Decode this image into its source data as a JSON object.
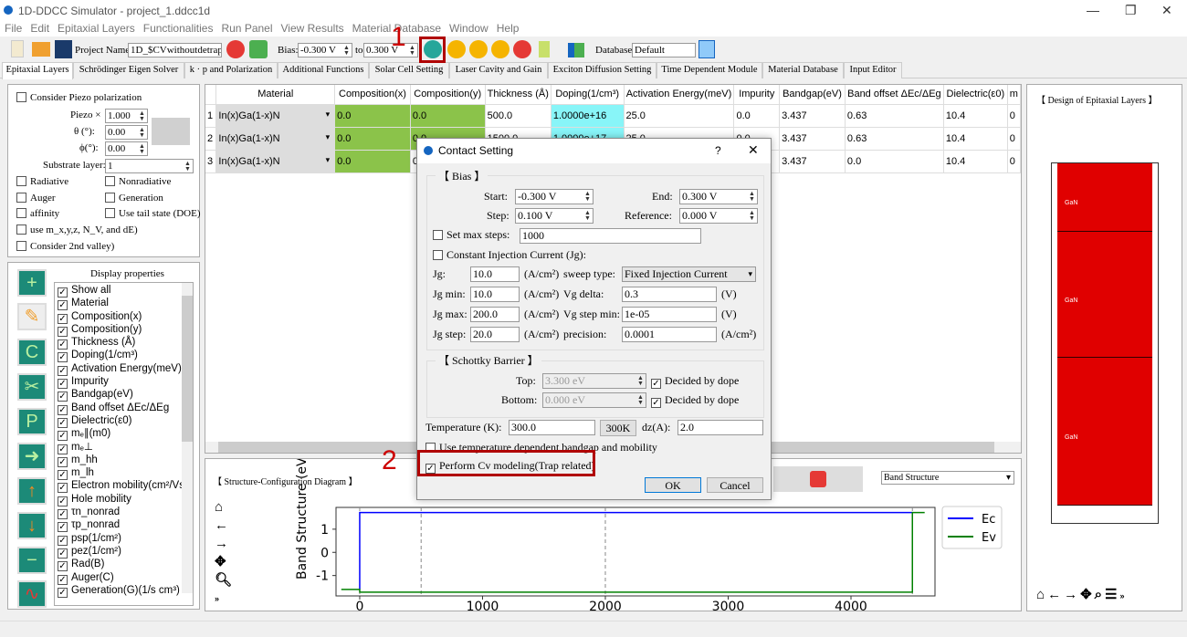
{
  "window": {
    "title": "1D-DDCC Simulator - project_1.ddcc1d"
  },
  "menu": [
    "File",
    "Edit",
    "Epitaxial Layers",
    "Functionalities",
    "Run Panel",
    "View Results",
    "Material Database",
    "Window",
    "Help"
  ],
  "toolbar": {
    "project_label": "Project Name:",
    "project_value": "1D_$CVwithoutdetrap",
    "bias_label": "Bias:",
    "bias_from": "-0.300 V",
    "to_label": "to",
    "bias_to": "0.300 V",
    "database_label": "Database:",
    "database_value": "Default"
  },
  "tabs": [
    "Epitaxial Layers",
    "Schrödinger Eigen Solver",
    "k · p and Polarization",
    "Additional Functions",
    "Solar Cell Setting",
    "Laser Cavity and Gain",
    "Exciton Diffusion Setting",
    "Time Dependent Module",
    "Material Database",
    "Input Editor"
  ],
  "left_top": {
    "piezo_label": "Consider Piezo polarization",
    "piezo_x_label": "Piezo ×",
    "piezo_x": "1.000",
    "theta_label": "θ (°):",
    "theta": "0.00",
    "phi_label": "ϕ(°):",
    "phi": "0.00",
    "substrate_label": "Substrate layer:",
    "substrate": "1",
    "checks": [
      "Radiative",
      "Nonradiative",
      "Auger",
      "Generation",
      "affinity",
      "Use tail state (DOE)",
      "use m_x,y,z, N_V, and dE)",
      "Consider 2nd valley)"
    ]
  },
  "display": {
    "title": "Display properties",
    "items": [
      "Show all",
      "Material",
      "Composition(x)",
      "Composition(y)",
      "Thickness (Å)",
      "Doping(1/cm³)",
      "Activation Energy(meV)",
      "Impurity",
      "Bandgap(eV)",
      "Band offset ΔEc/ΔEg",
      "Dielectric(ε0)",
      "mₑ∥(m0)",
      "mₑ⊥",
      "m_hh",
      "m_lh",
      "Electron mobility(cm²/Vs)",
      "Hole mobility",
      "τn_nonrad",
      "τp_nonrad",
      "psp(1/cm²)",
      "pez(1/cm²)",
      "Rad(B)",
      "Auger(C)",
      "Generation(G)(1/s cm³)"
    ]
  },
  "table": {
    "headers": [
      "Material",
      "Composition(x)",
      "Composition(y)",
      "Thickness (Å)",
      "Doping(1/cm³)",
      "Activation Energy(meV)",
      "Impurity",
      "Bandgap(eV)",
      "Band offset ΔEc/ΔEg",
      "Dielectric(ε0)",
      "m"
    ],
    "rows": [
      [
        "1",
        "In(x)Ga(1-x)N",
        "0.0",
        "0.0",
        "500.0",
        "1.0000e+16",
        "25.0",
        "0.0",
        "3.437",
        "0.63",
        "10.4",
        "0"
      ],
      [
        "2",
        "In(x)Ga(1-x)N",
        "0.0",
        "0.0",
        "1500.0",
        "1.0000e+17",
        "25.0",
        "0.0",
        "3.437",
        "0.63",
        "10.4",
        "0"
      ],
      [
        "3",
        "In(x)Ga(1-x)N",
        "0.0",
        "0.0",
        "",
        "",
        "",
        "",
        "3.437",
        "0.0",
        "10.4",
        "0"
      ]
    ]
  },
  "structure": {
    "title": "【 Structure-Configuration Diagram 】",
    "plot_select": "Band Structure"
  },
  "design": {
    "title": "【 Design of Epitaxial Layers 】",
    "layers": [
      "GaN",
      "GaN",
      "GaN"
    ],
    "layer_color": "#e00000"
  },
  "dialog": {
    "title": "Contact Setting",
    "help": "?",
    "close": "✕",
    "bias_group": "【 Bias 】",
    "start_label": "Start:",
    "start": "-0.300 V",
    "end_label": "End:",
    "end": "0.300 V",
    "step_label": "Step:",
    "step": "0.100 V",
    "reference_label": "Reference:",
    "reference": "0.000 V",
    "max_steps_label": "Set max steps:",
    "max_steps": "1000",
    "const_inj_label": "Constant Injection Current (Jg):",
    "jg_label": "Jg:",
    "jg": "10.0",
    "jg_min_label": "Jg min:",
    "jg_min": "10.0",
    "jg_max_label": "Jg max:",
    "jg_max": "200.0",
    "jg_step_label": "Jg step:",
    "jg_step": "20.0",
    "unit_acm2": "(A/cm²)",
    "unit_v": "(V)",
    "sweep_label": "sweep type:",
    "sweep": "Fixed Injection Current",
    "vg_delta_label": "Vg delta:",
    "vg_delta": "0.3",
    "vg_step_min_label": "Vg step min:",
    "vg_step_min": "1e-05",
    "precision_label": "precision:",
    "precision": "0.0001",
    "schottky_group": "【 Schottky Barrier 】",
    "top_label": "Top:",
    "top": "3.300 eV",
    "bottom_label": "Bottom:",
    "bottom": "0.000 eV",
    "decided": "Decided by dope",
    "temp_label": "Temperature (K):",
    "temp": "300.0",
    "temp_btn": "300K",
    "dz_label": "dz(A):",
    "dz": "2.0",
    "temp_dep_label": "Use temperature dependent bandgap and mobility",
    "cv_label": "Perform Cv modeling(Trap related)",
    "ok": "OK",
    "cancel": "Cancel"
  },
  "annotations": {
    "step1": "1",
    "step2": "2",
    "color": "#b00000"
  },
  "chart_data": {
    "type": "line",
    "ylabel": "Band Structure (eV)",
    "xlim": [
      -193,
      4684
    ],
    "ylim": [
      -1.88,
      1.94
    ],
    "xticks": [
      0,
      1000,
      2000,
      3000,
      4000
    ],
    "yticks": [
      -1,
      0,
      1
    ],
    "vlines": [
      0,
      500,
      2000,
      4500
    ],
    "legend": "right-outside",
    "series": [
      {
        "name": "Ec",
        "color": "#0000ff",
        "x": [
          0,
          0,
          4500
        ],
        "y": [
          -1.6,
          1.72,
          1.72
        ]
      },
      {
        "name": "Ev",
        "color": "#008000",
        "x": [
          -150,
          0,
          0,
          4500,
          4500,
          4600
        ],
        "y": [
          -1.6,
          -1.6,
          -1.72,
          -1.72,
          1.72,
          1.72
        ]
      }
    ]
  }
}
